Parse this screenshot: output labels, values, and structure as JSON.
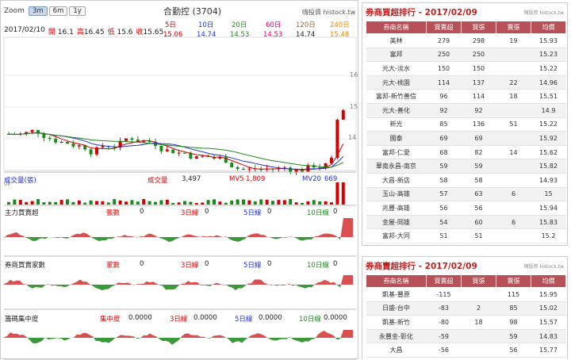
{
  "toolbar": {
    "zoom_label": "Zoom",
    "buttons": [
      "3m",
      "6m",
      "1y"
    ],
    "active": "3m"
  },
  "chart": {
    "title": "合勤控 (3704)",
    "brand": "嗨投資 histock.tw",
    "info": {
      "date": "2017/02/10",
      "open_label": "開",
      "open": "16.1",
      "high_label": "高",
      "high": "16.45",
      "low_label": "低",
      "low": "15.6",
      "close_label": "收",
      "close": "15.65"
    },
    "ma": [
      {
        "label": "5日",
        "value": "15.06",
        "color": "#d40000"
      },
      {
        "label": "10日",
        "value": "14.74",
        "color": "#2233cc"
      },
      {
        "label": "20日",
        "value": "14.53",
        "color": "#228822"
      },
      {
        "label": "60日",
        "value": "14.53",
        "color": "#d0006f"
      },
      {
        "label": "120日",
        "value": "14.74",
        "color": "#996633"
      },
      {
        "label": "240日",
        "value": "15.48",
        "color": "#ee8800"
      }
    ],
    "price_axis": [
      "16",
      "15",
      "14"
    ],
    "volume": {
      "label": "成交量(張)",
      "vol_label": "成交量",
      "vol": "3,497",
      "mv5_label": "MV5",
      "mv5": "1,809",
      "mv20_label": "MV20",
      "mv20": "669",
      "axis": "0k"
    },
    "main_force": {
      "label": "主力買賣超",
      "c1_label": "張數",
      "c1": "0",
      "c2_label": "3日線",
      "c2": "0",
      "c3_label": "5日線",
      "c3": "0",
      "c4_label": "10日線",
      "c4": "0"
    },
    "brokers": {
      "label": "券商買賣家數",
      "c1_label": "家數",
      "c1": "0",
      "c2_label": "3日線",
      "c2": "0",
      "c3_label": "5日線",
      "c3": "0",
      "c4_label": "10日線",
      "c4": "0"
    },
    "concentration": {
      "label": "籌碼集中度",
      "c1_label": "集中度",
      "c1": "0.0000",
      "c2_label": "3日線",
      "c2": "0.0000",
      "c3_label": "5日線",
      "c3": "0.0000",
      "c4_label": "10日線",
      "c4": "0.0000"
    }
  },
  "buy_ranking": {
    "title": "券商買超排行 - 2017/02/09",
    "source": "嗨投資 histock.tw",
    "headers": [
      "券商名稱",
      "買賣超",
      "買張",
      "賣張",
      "均價"
    ],
    "rows": [
      [
        "美林",
        "279",
        "298",
        "19",
        "15.93"
      ],
      [
        "富邦",
        "250",
        "250",
        "",
        "15.23"
      ],
      [
        "元大-淡水",
        "150",
        "150",
        "",
        "15.22"
      ],
      [
        "元大-桃園",
        "114",
        "137",
        "22",
        "14.96"
      ],
      [
        "富邦-新竹善信",
        "96",
        "114",
        "18",
        "15.51"
      ],
      [
        "元大-善化",
        "92",
        "92",
        "",
        "14.9"
      ],
      [
        "新光",
        "85",
        "136",
        "51",
        "15.22"
      ],
      [
        "國泰",
        "69",
        "69",
        "",
        "15.92"
      ],
      [
        "富邦-仁愛",
        "68",
        "82",
        "14",
        "15.62"
      ],
      [
        "華南永昌-南京",
        "59",
        "59",
        "",
        "15.82"
      ],
      [
        "大昌-新店",
        "58",
        "58",
        "",
        "14.93"
      ],
      [
        "玉山-高雄",
        "57",
        "63",
        "6",
        "15"
      ],
      [
        "兆豐-高雄",
        "56",
        "56",
        "",
        "15.94"
      ],
      [
        "金屋-岡雄",
        "54",
        "60",
        "6",
        "15.83"
      ],
      [
        "富邦-大同",
        "51",
        "51",
        "",
        "15.2"
      ]
    ]
  },
  "sell_ranking": {
    "title": "券商賣超排行 - 2017/02/09",
    "source": "嗨投資 histock.tw",
    "headers": [
      "券商名稱",
      "買賣超",
      "買張",
      "賣張",
      "均價"
    ],
    "rows": [
      [
        "凱基-豐原",
        "-115",
        "",
        "115",
        "15.95"
      ],
      [
        "日盛-台中",
        "-83",
        "2",
        "85",
        "15.02"
      ],
      [
        "凱基-新竹",
        "-80",
        "18",
        "98",
        "15.57"
      ],
      [
        "永豐金-彰化",
        "-59",
        "",
        "59",
        "14.83"
      ],
      [
        "大昌",
        "-56",
        "",
        "56",
        "15.77"
      ]
    ]
  }
}
